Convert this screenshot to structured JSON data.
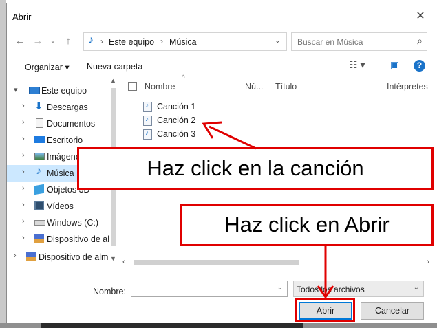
{
  "window": {
    "title": "Abrir"
  },
  "nav": {
    "breadcrumb": [
      "Este equipo",
      "Música"
    ],
    "search_placeholder": "Buscar en Música"
  },
  "toolbar": {
    "organize_label": "Organizar ▾",
    "new_folder_label": "Nueva carpeta"
  },
  "sidebar": {
    "items": [
      {
        "label": "Este equipo",
        "icon": "pc-icon",
        "chev": "▾",
        "selected": false
      },
      {
        "label": "Descargas",
        "icon": "downloads-icon",
        "chev": "›",
        "selected": false
      },
      {
        "label": "Documentos",
        "icon": "documents-icon",
        "chev": "›",
        "selected": false
      },
      {
        "label": "Escritorio",
        "icon": "desktop-icon",
        "chev": "›",
        "selected": false
      },
      {
        "label": "Imágenes",
        "icon": "pictures-icon",
        "chev": "›",
        "selected": false
      },
      {
        "label": "Música",
        "icon": "music-icon",
        "chev": "›",
        "selected": true
      },
      {
        "label": "Objetos 3D",
        "icon": "3d-objects-icon",
        "chev": "›",
        "selected": false
      },
      {
        "label": "Vídeos",
        "icon": "videos-icon",
        "chev": "›",
        "selected": false
      },
      {
        "label": "Windows (C:)",
        "icon": "drive-icon",
        "chev": "›",
        "selected": false
      },
      {
        "label": "Dispositivo de al",
        "icon": "removable-drive-icon",
        "chev": "›",
        "selected": false
      },
      {
        "label": "Dispositivo de alm",
        "icon": "removable-drive-icon",
        "chev": "›",
        "selected": false
      }
    ]
  },
  "files": {
    "columns": [
      "Nombre",
      "Nú...",
      "Título",
      "Intérpretes"
    ],
    "rows": [
      "Canción 1",
      "Canción 2",
      "Canción 3"
    ]
  },
  "footer": {
    "name_label": "Nombre:",
    "name_value": "",
    "type_value": "Todos los archivos",
    "open_label": "Abrir",
    "cancel_label": "Cancelar"
  },
  "annotations": {
    "song_callout": "Haz click en la canción",
    "open_callout": "Haz click en Abrir",
    "color": "#e00000"
  }
}
